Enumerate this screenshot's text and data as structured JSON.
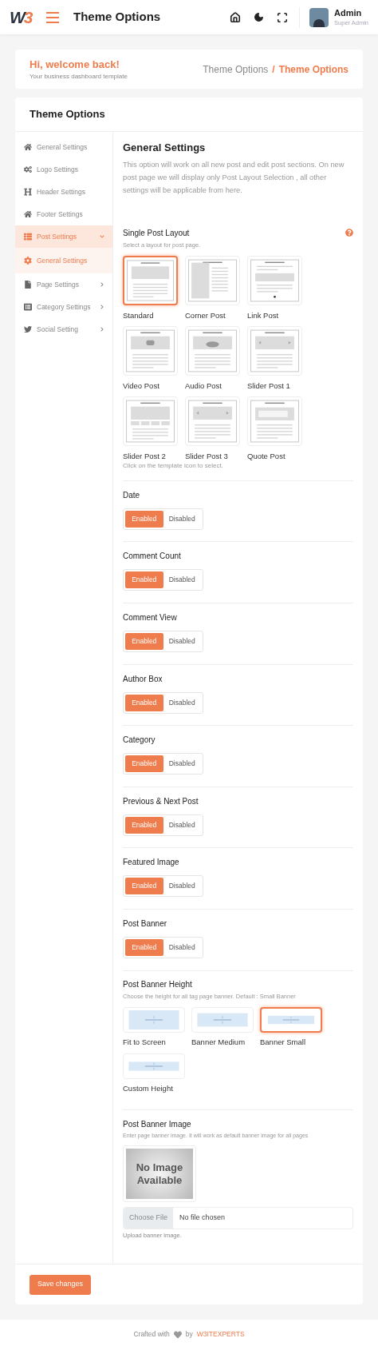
{
  "header": {
    "logo": [
      "W",
      "3"
    ],
    "title": "Theme Options",
    "user": {
      "name": "Admin",
      "role": "Super Admin"
    }
  },
  "welcome": {
    "title": "Hi, welcome back!",
    "subtitle": "Your business dashboard template"
  },
  "breadcrumb": {
    "separator": "/",
    "items": [
      {
        "label": "Theme Options",
        "selected": false
      },
      {
        "label": "Theme Options",
        "selected": true
      }
    ]
  },
  "card_title": "Theme Options",
  "sidebar": {
    "items": [
      {
        "label": "General Settings",
        "kind": "link",
        "selected": false
      },
      {
        "label": "Logo Settings",
        "kind": "link",
        "selected": false
      },
      {
        "label": "Header Settings",
        "kind": "link",
        "selected": false
      },
      {
        "label": "Footer Settings",
        "kind": "link",
        "selected": false
      },
      {
        "label": "Post Settings",
        "kind": "group",
        "selected": true,
        "expanded": true,
        "children": [
          {
            "label": "General Settings",
            "selected": true
          }
        ]
      },
      {
        "label": "Page Settings",
        "kind": "group",
        "selected": false,
        "expanded": false
      },
      {
        "label": "Category Settings",
        "kind": "group",
        "selected": false,
        "expanded": false
      },
      {
        "label": "Social Setting",
        "kind": "group",
        "selected": false,
        "expanded": false
      }
    ]
  },
  "section": {
    "title": "General Settings",
    "description": "This option will work on all new post and edit post sections. On new post page we will display only Post Layout Selection , all other settings will be applicable from here."
  },
  "single_post_layout": {
    "label": "Single Post Layout",
    "hint": "Select a layout for post page.",
    "footnote": "Click on the template icon to select.",
    "options": [
      {
        "label": "Standard",
        "kind": "feature",
        "selected": true
      },
      {
        "label": "Corner Post",
        "kind": "corner",
        "selected": false
      },
      {
        "label": "Link Post",
        "kind": "link",
        "selected": false
      },
      {
        "label": "Video Post",
        "kind": "video",
        "selected": false
      },
      {
        "label": "Audio Post",
        "kind": "audio",
        "selected": false
      },
      {
        "label": "Slider Post 1",
        "kind": "slider",
        "selected": false
      },
      {
        "label": "Slider Post 2",
        "kind": "gallery",
        "selected": false
      },
      {
        "label": "Slider Post 3",
        "kind": "slider",
        "selected": false
      },
      {
        "label": "Quote Post",
        "kind": "quote",
        "selected": false
      }
    ]
  },
  "toggles": [
    {
      "label": "Date",
      "options": [
        {
          "label": "Enabled",
          "selected": true
        },
        {
          "label": "Disabled",
          "selected": false
        }
      ]
    },
    {
      "label": "Comment Count",
      "options": [
        {
          "label": "Enabled",
          "selected": true
        },
        {
          "label": "Disabled",
          "selected": false
        }
      ]
    },
    {
      "label": "Comment View",
      "options": [
        {
          "label": "Enabled",
          "selected": true
        },
        {
          "label": "Disabled",
          "selected": false
        }
      ]
    },
    {
      "label": "Author Box",
      "options": [
        {
          "label": "Enabled",
          "selected": true
        },
        {
          "label": "Disabled",
          "selected": false
        }
      ]
    },
    {
      "label": "Category",
      "options": [
        {
          "label": "Enabled",
          "selected": true
        },
        {
          "label": "Disabled",
          "selected": false
        }
      ]
    },
    {
      "label": "Previous & Next Post",
      "options": [
        {
          "label": "Enabled",
          "selected": true
        },
        {
          "label": "Disabled",
          "selected": false
        }
      ]
    },
    {
      "label": "Featured Image",
      "options": [
        {
          "label": "Enabled",
          "selected": true
        },
        {
          "label": "Disabled",
          "selected": false
        }
      ]
    },
    {
      "label": "Post Banner",
      "options": [
        {
          "label": "Enabled",
          "selected": true
        },
        {
          "label": "Disabled",
          "selected": false
        }
      ]
    }
  ],
  "banner_height": {
    "label": "Post Banner Height",
    "hint": "Choose the height for all tag page banner. Default : Small Banner",
    "options": [
      {
        "label": "Fit to Screen",
        "kind": "big",
        "selected": false
      },
      {
        "label": "Banner Medium",
        "kind": "medium",
        "selected": false
      },
      {
        "label": "Banner Small",
        "kind": "small",
        "selected": true
      },
      {
        "label": "Custom Height",
        "kind": "small",
        "selected": false
      }
    ]
  },
  "banner_image": {
    "label": "Post Banner Image",
    "hint": "Enter page banner image. It will work as default banner image for all pages",
    "image_text": "No Image Available",
    "choose_button": "Choose File",
    "file_status": "No file chosen",
    "note": "Upload banner image."
  },
  "save_button": "Save changes",
  "footer": {
    "text": "Crafted with",
    "by": "by",
    "brand": "W3ITEXPERTS"
  }
}
